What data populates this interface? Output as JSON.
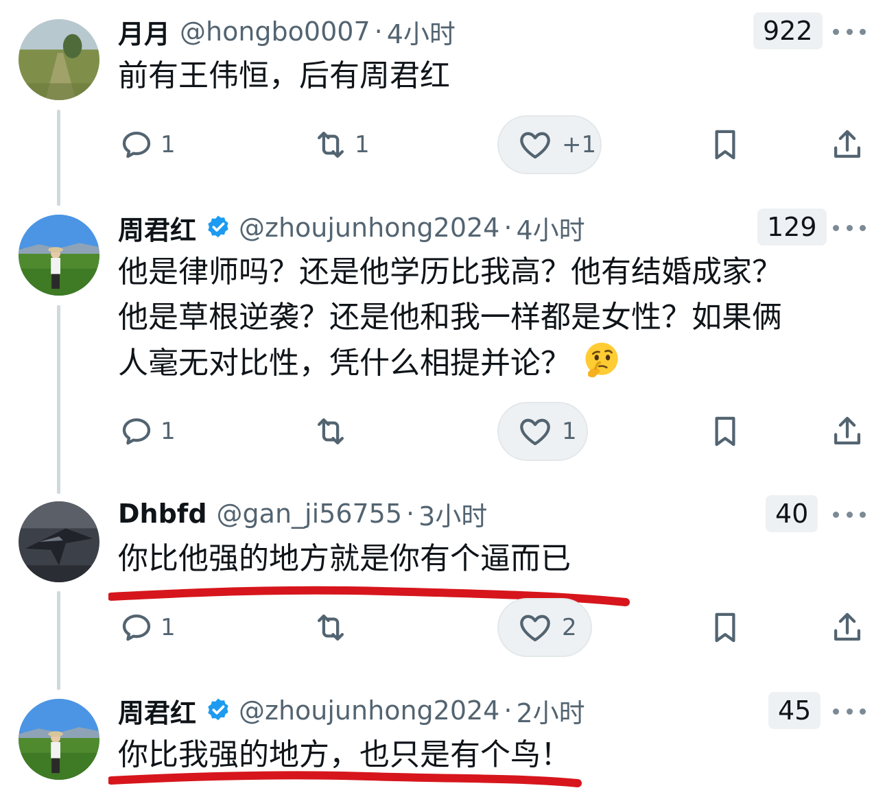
{
  "tweets": [
    {
      "name": "月月",
      "verified": false,
      "handle": "@hongbo0007",
      "separator": "·",
      "time": "4小时",
      "view_count": "922",
      "text_lines": [
        "前有王伟恒，后有周君红"
      ],
      "reply_count": "1",
      "retweet_count": "1",
      "like_count": "+1"
    },
    {
      "name": "周君红",
      "verified": true,
      "handle": "@zhoujunhong2024",
      "separator": "·",
      "time": "4小时",
      "view_count": "129",
      "text_lines": [
        "他是律师吗？还是他学历比我高？他有结婚成家？",
        "他是草根逆袭？还是他和我一样都是女性？如果俩",
        "人毫无对比性，凭什么相提并论？"
      ],
      "emoji": "thinking-face",
      "reply_count": "1",
      "retweet_count": "",
      "like_count": "1"
    },
    {
      "name": "Dhbfd",
      "verified": false,
      "handle": "@gan_ji56755",
      "separator": "·",
      "time": "3小时",
      "view_count": "40",
      "text_lines": [
        "你比他强的地方就是你有个逼而已"
      ],
      "reply_count": "1",
      "retweet_count": "",
      "like_count": "2"
    },
    {
      "name": "周君红",
      "verified": true,
      "handle": "@zhoujunhong2024",
      "separator": "·",
      "time": "2小时",
      "view_count": "45",
      "text_lines": [
        "你比我强的地方，也只是有个鸟！"
      ]
    }
  ],
  "colors": {
    "text": "#0f1419",
    "secondary": "#536471",
    "verified": "#1d9bf0",
    "thread_line": "#cfd9de",
    "underline": "#d6161c"
  }
}
